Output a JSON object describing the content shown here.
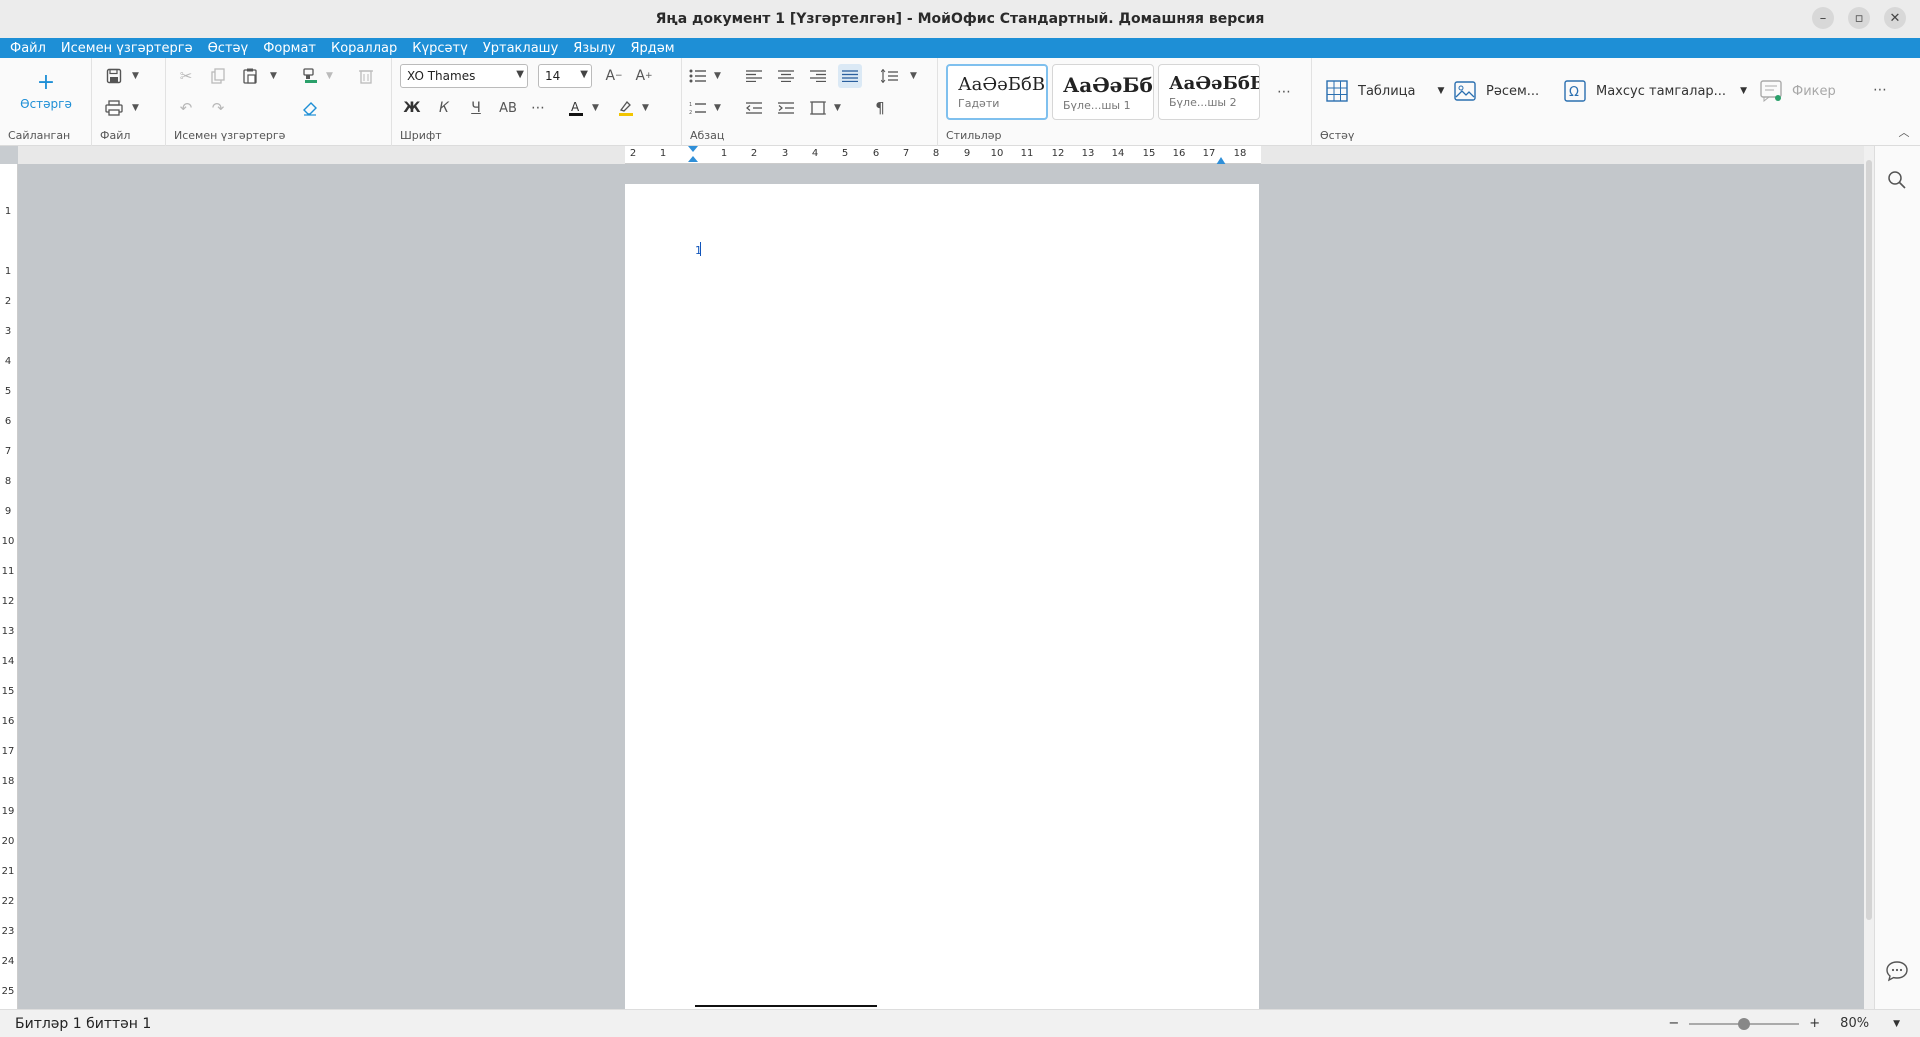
{
  "window": {
    "title": "Яңа документ 1 [Үзгәртелгән] - МойОфис Стандартный. Домашняя версия",
    "minimize": "–",
    "restore": "▫",
    "close": "✕"
  },
  "menu": [
    "Файл",
    "Исемен үзгәртергә",
    "Өстәү",
    "Формат",
    "Кораллар",
    "Күрсәтү",
    "Уртаклашу",
    "Язылу",
    "Ярдәм"
  ],
  "ribbon": {
    "groups": {
      "favorites": "Сайланган",
      "file": "Файл",
      "edit": "Исемен үзгәртергә",
      "font": "Шрифт",
      "paragraph": "Абзац",
      "styles": "Стильләр",
      "insert": "Өстәү"
    },
    "add_label": "Өстәргә",
    "font_name": "XO Thames",
    "font_size": "14",
    "format_buttons": {
      "bold": "Ж",
      "italic": "К",
      "underline": "Ч",
      "caps": "АВ",
      "more": "⋯"
    },
    "styles": [
      {
        "sample": "АаӘәБбВ",
        "name": "Гадәти"
      },
      {
        "sample": "АаӘәБб",
        "name": "Бүле...шы 1"
      },
      {
        "sample": "АаӘәБбВ",
        "name": "Бүле...шы 2"
      }
    ],
    "more": "⋯",
    "insert_items": {
      "table": "Таблица",
      "picture": "Рәсем...",
      "special": "Махсус тамгалар...",
      "comment": "Фикер"
    }
  },
  "ruler": {
    "h_ticks": [
      "2",
      "1",
      "",
      "1",
      "2",
      "3",
      "4",
      "5",
      "6",
      "7",
      "8",
      "9",
      "10",
      "11",
      "12",
      "13",
      "14",
      "15",
      "16",
      "17",
      "18"
    ],
    "v_ticks": [
      "1",
      "",
      "1",
      "2",
      "3",
      "4",
      "5",
      "6",
      "7",
      "8",
      "9",
      "10",
      "11",
      "12",
      "13",
      "14",
      "15",
      "16",
      "17",
      "18",
      "19",
      "20",
      "21",
      "22",
      "23",
      "24",
      "25"
    ]
  },
  "document": {
    "first_char": "1"
  },
  "status": {
    "pages": "Битләр 1 биттән 1",
    "zoom_minus": "−",
    "zoom_plus": "+",
    "zoom_value": "80%",
    "zoom_fraction": 0.5
  }
}
